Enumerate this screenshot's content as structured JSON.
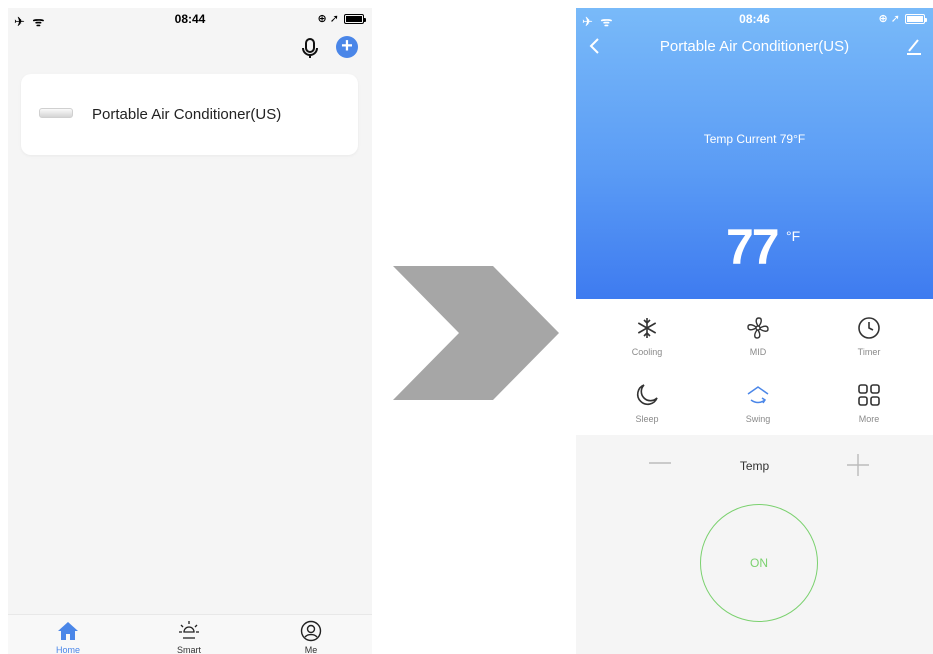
{
  "left_screen": {
    "status": {
      "left_icons": "✈ ᯤ",
      "time": "08:44",
      "right_icons": "⊕ ➚"
    },
    "device": {
      "name": "Portable Air Conditioner(US)"
    },
    "tabs": [
      {
        "label": "Home",
        "icon": "home-icon"
      },
      {
        "label": "Smart",
        "icon": "sun-icon"
      },
      {
        "label": "Me",
        "icon": "user-icon"
      }
    ],
    "accent_color": "#4a86e8"
  },
  "right_screen": {
    "status": {
      "left_icons": "✈ ᯤ",
      "time": "08:46",
      "right_icons": "⊕ ➚"
    },
    "title": "Portable Air Conditioner(US)",
    "temp_current": "Temp Current  79°F",
    "temp_set": "77",
    "temp_unit": "°F",
    "modes": [
      {
        "label": "Cooling",
        "icon": "snowflake-icon"
      },
      {
        "label": "MID",
        "icon": "fan-icon"
      },
      {
        "label": "Timer",
        "icon": "clock-icon"
      },
      {
        "label": "Sleep",
        "icon": "moon-icon"
      },
      {
        "label": "Swing",
        "icon": "swing-icon"
      },
      {
        "label": "More",
        "icon": "grid-icon"
      }
    ],
    "temp_label": "Temp",
    "power_label": "ON",
    "power_color": "#7bd16f"
  }
}
